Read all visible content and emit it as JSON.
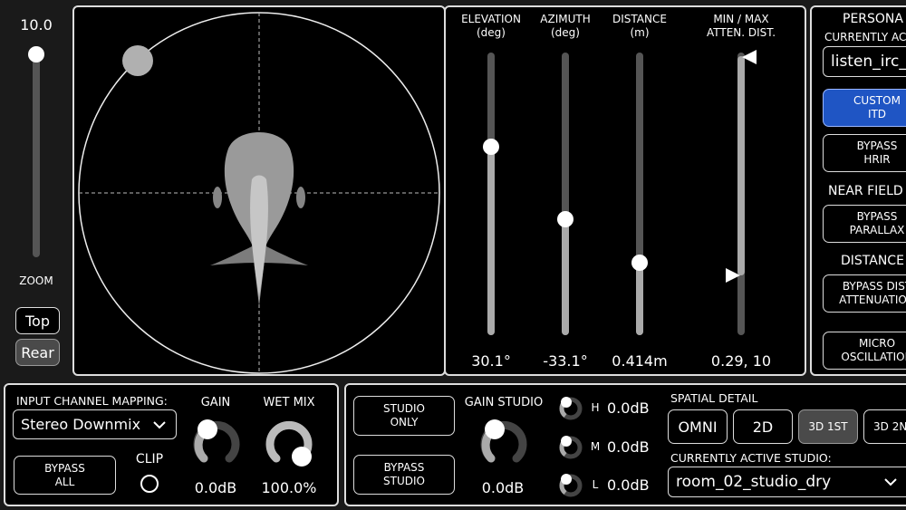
{
  "zoom": {
    "value_label": "10.0",
    "label": "ZOOM",
    "level": 0.95,
    "top_label": "Top",
    "rear_label": "Rear"
  },
  "sliders": {
    "elevation": {
      "title": "ELEVATION\n(deg)",
      "value_label": "30.1°",
      "value": 30.1
    },
    "azimuth": {
      "title": "AZIMUTH\n(deg)",
      "value_label": "-33.1°",
      "value": -33.1
    },
    "distance": {
      "title": "DISTANCE\n(m)",
      "value_label": "0.414m",
      "value": 0.414
    },
    "atten": {
      "title": "MIN / MAX\nATTEN. DIST.",
      "value_label": "0.29, 10",
      "min": 0.29,
      "max": 10
    }
  },
  "right_panel": {
    "personal_label": "PERSONA",
    "currently_active_label": "CURRENTLY AC",
    "hrtf_value": "listen_irc_",
    "custom_itd": "CUSTOM\nITD",
    "bypass_hrir": "BYPASS\nHRIR",
    "near_field_label": "NEAR FIELD",
    "bypass_parallax": "BYPASS\nPARALLAX",
    "distance_label": "DISTANCE",
    "bypass_dist": "BYPASS DIST\nATTENUATION",
    "micro_osc": "MICRO\nOSCILLATION"
  },
  "input": {
    "mapping_label": "INPUT CHANNEL MAPPING:",
    "mapping_value": "Stereo Downmix",
    "bypass_all": "BYPASS\nALL",
    "clip_label": "CLIP",
    "gain_label": "GAIN",
    "gain_value": "0.0dB",
    "wet_label": "WET MIX",
    "wet_value": "100.0%"
  },
  "studio": {
    "studio_only": "STUDIO\nONLY",
    "bypass_studio": "BYPASS\nSTUDIO",
    "gain_label": "GAIN STUDIO",
    "gain_value": "0.0dB",
    "h_label": "H",
    "h_value": "0.0dB",
    "m_label": "M",
    "m_value": "0.0dB",
    "l_label": "L",
    "l_value": "0.0dB",
    "spatial_label": "SPATIAL DETAIL",
    "omni": "OMNI",
    "two_d": "2D",
    "three_d_1st": "3D 1ST",
    "three_d_2nd": "3D 2N",
    "active_label": "CURRENTLY ACTIVE STUDIO:",
    "active_value": "room_02_studio_dry"
  },
  "colors": {
    "accent_blue": "#1f55c4",
    "panel_border": "#dddddd"
  }
}
